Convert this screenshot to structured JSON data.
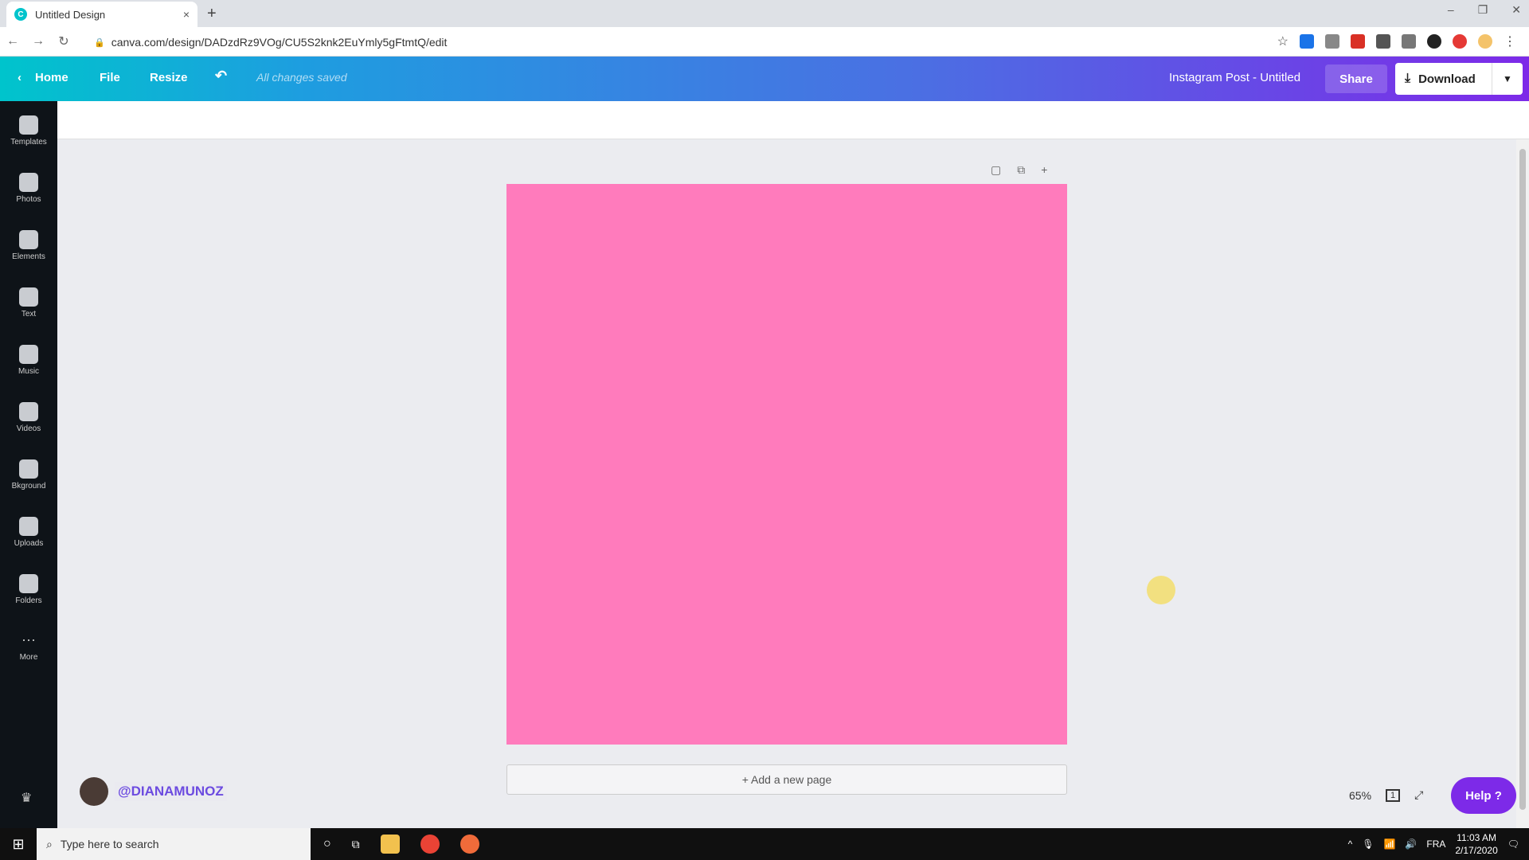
{
  "browser": {
    "tab_title": "Untitled Design",
    "tab_close": "×",
    "new_tab": "+",
    "url": "canva.com/design/DADzdRz9VOg/CU5S2knk2EuYmly5gFtmtQ/edit",
    "window_controls": [
      "–",
      "❐",
      "✕"
    ]
  },
  "canva_header": {
    "home_label": "Home",
    "file_label": "File",
    "resize_label": "Resize",
    "undo_icon": "↶",
    "saved_status": "All changes saved",
    "design_title": "Instagram Post - Untitled",
    "share_label": "Share",
    "download_label": "Download"
  },
  "sidebar": {
    "items": [
      {
        "label": "Templates",
        "icon": "templates-icon"
      },
      {
        "label": "Photos",
        "icon": "photos-icon"
      },
      {
        "label": "Elements",
        "icon": "elements-icon"
      },
      {
        "label": "Text",
        "icon": "text-icon"
      },
      {
        "label": "Music",
        "icon": "music-icon"
      },
      {
        "label": "Videos",
        "icon": "videos-icon"
      },
      {
        "label": "Bkground",
        "icon": "background-icon"
      },
      {
        "label": "Uploads",
        "icon": "uploads-icon"
      },
      {
        "label": "Folders",
        "icon": "folders-icon"
      },
      {
        "label": "More",
        "icon": "more-icon"
      }
    ]
  },
  "canvas": {
    "page_color": "#ff7bbc",
    "add_page_label": "+ Add a new page"
  },
  "footer": {
    "watermark_handle": "@DIANAMUNOZ",
    "zoom_level": "65%",
    "page_count": "1",
    "help_label": "Help ?"
  },
  "taskbar": {
    "search_placeholder": "Type here to search",
    "language": "FRA",
    "time": "11:03 AM",
    "date": "2/17/2020"
  },
  "colors": {
    "accent_purple": "#7d2ae8",
    "accent_teal": "#00c4cc",
    "sidebar_bg": "#0e1318"
  }
}
